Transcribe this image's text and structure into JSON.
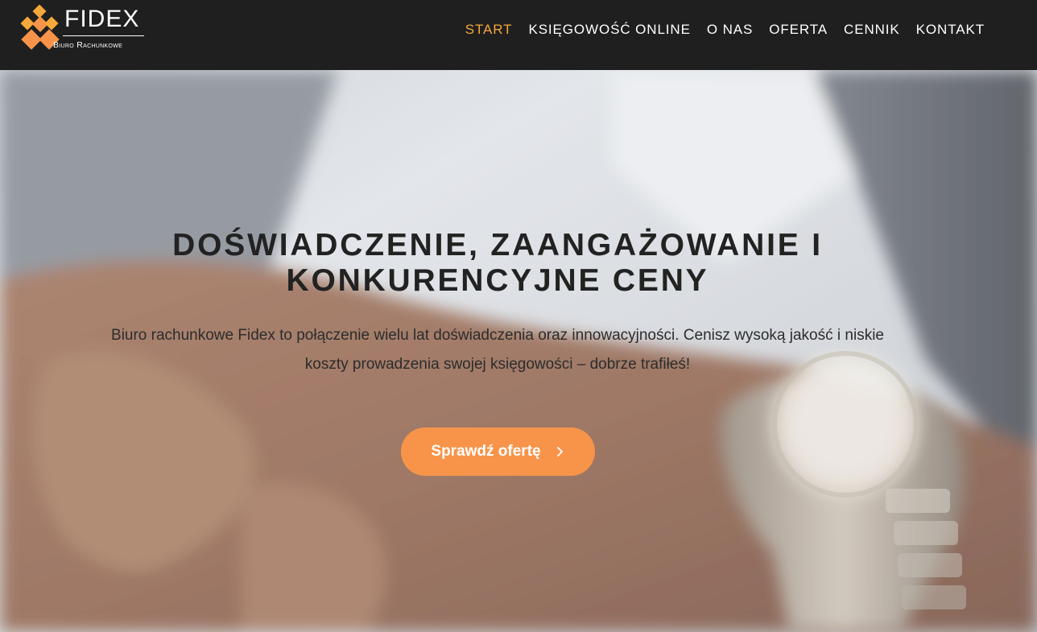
{
  "brand": {
    "name": "FIDEX",
    "tagline": "Biuro Rachunkowe",
    "colors": {
      "orange": "#f7944a",
      "yellow": "#f5a83a",
      "header_bg": "#1f1f1f"
    }
  },
  "nav": {
    "items": [
      {
        "label": "START",
        "active": true
      },
      {
        "label": "KSIĘGOWOŚĆ ONLINE",
        "active": false
      },
      {
        "label": "O NAS",
        "active": false
      },
      {
        "label": "OFERTA",
        "active": false
      },
      {
        "label": "CENNIK",
        "active": false
      },
      {
        "label": "KONTAKT",
        "active": false
      }
    ]
  },
  "hero": {
    "title": "Doświadczenie, zaangażowanie i konkurencyjne ceny",
    "text": "Biuro rachunkowe Fidex to połączenie wielu lat doświadczenia oraz innowacyjności. Cenisz wysoką jakość i niskie koszty prowadzenia swojej księgowości – dobrze trafiłeś!",
    "cta_label": "Sprawdź ofertę",
    "cta_icon": "chevron-right-icon"
  }
}
